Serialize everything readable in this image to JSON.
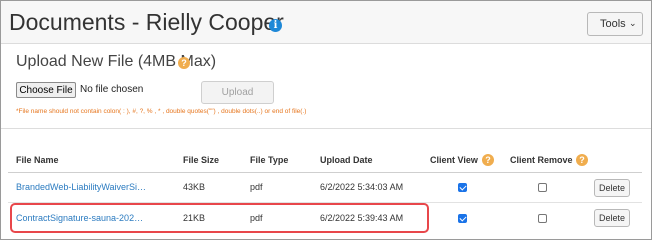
{
  "header": {
    "title": "Documents - Rielly Cooper",
    "info_icon_glyph": "i",
    "tools_label": "Tools",
    "tools_chevron": "⌄"
  },
  "upload": {
    "title": "Upload New File (4MB Max)",
    "warn_glyph": "?",
    "choose_label": "Choose File",
    "no_file_text": "No file chosen",
    "upload_label": "Upload",
    "note": "*File name should not contain colon( : ), #, ?, % , * , double quotes(\"\") , double dots(..) or end of file(.)"
  },
  "table": {
    "columns": {
      "file_name": "File Name",
      "file_size": "File Size",
      "file_type": "File Type",
      "upload_date": "Upload Date",
      "client_view": "Client View",
      "client_remove": "Client Remove"
    },
    "rows": [
      {
        "name": "BrandedWeb-LiabilityWaiverSi…",
        "size": "43KB",
        "type": "pdf",
        "date": "6/2/2022 5:34:03 AM",
        "client_view": true,
        "client_remove": false,
        "delete_label": "Delete"
      },
      {
        "name": "ContractSignature-sauna-202…",
        "size": "21KB",
        "type": "pdf",
        "date": "6/2/2022 5:39:43 AM",
        "client_view": true,
        "client_remove": false,
        "delete_label": "Delete"
      }
    ]
  },
  "colors": {
    "link": "#2b7bc0",
    "info": "#1e88d7",
    "warn": "#f0ad4e",
    "note": "#e6761e",
    "highlight": "#e8474b",
    "checkbox": "#1a73e8"
  },
  "icons": [
    "info-icon",
    "help-icon",
    "chevron-down-icon"
  ]
}
